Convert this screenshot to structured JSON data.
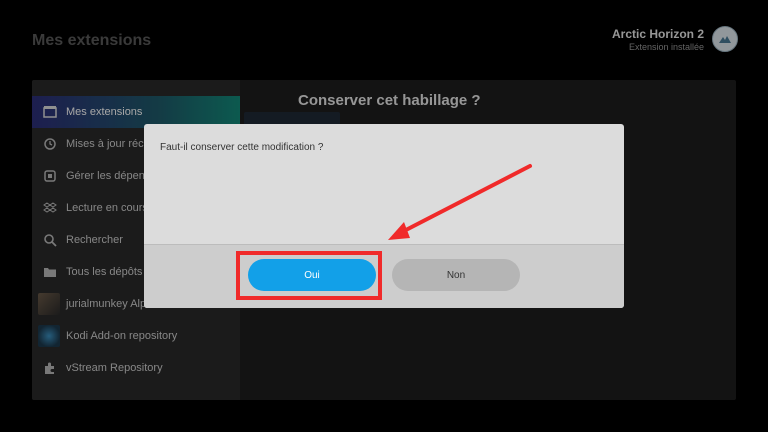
{
  "header": {
    "title": "Mes extensions",
    "notification": {
      "title": "Arctic Horizon 2",
      "subtitle": "Extension installée",
      "icon": "skin-logo-icon"
    }
  },
  "sidebar": {
    "items": [
      {
        "label": "Mes extensions",
        "icon": "package-icon",
        "active": true
      },
      {
        "label": "Mises à jour réce",
        "icon": "refresh-icon"
      },
      {
        "label": "Gérer les dépend",
        "icon": "dependencies-icon"
      },
      {
        "label": "Lecture en cours",
        "icon": "dropbox-icon"
      },
      {
        "label": "Rechercher",
        "icon": "search-icon"
      },
      {
        "label": "Tous les dépôts",
        "icon": "folder-icon"
      },
      {
        "label": "jurialmunkey Alp",
        "icon": "repo-thumbnail"
      },
      {
        "label": "Kodi Add-on repository",
        "icon": "kodi-thumbnail"
      },
      {
        "label": "vStream Repository",
        "icon": "puzzle-icon"
      }
    ]
  },
  "content": {
    "title": "Conserver cet habillage ?"
  },
  "dialog": {
    "message": "Faut-il conserver cette modification ?",
    "yes_label": "Oui",
    "no_label": "Non"
  },
  "colors": {
    "accent": "#12a0e8",
    "highlight": "#f02a2a"
  }
}
